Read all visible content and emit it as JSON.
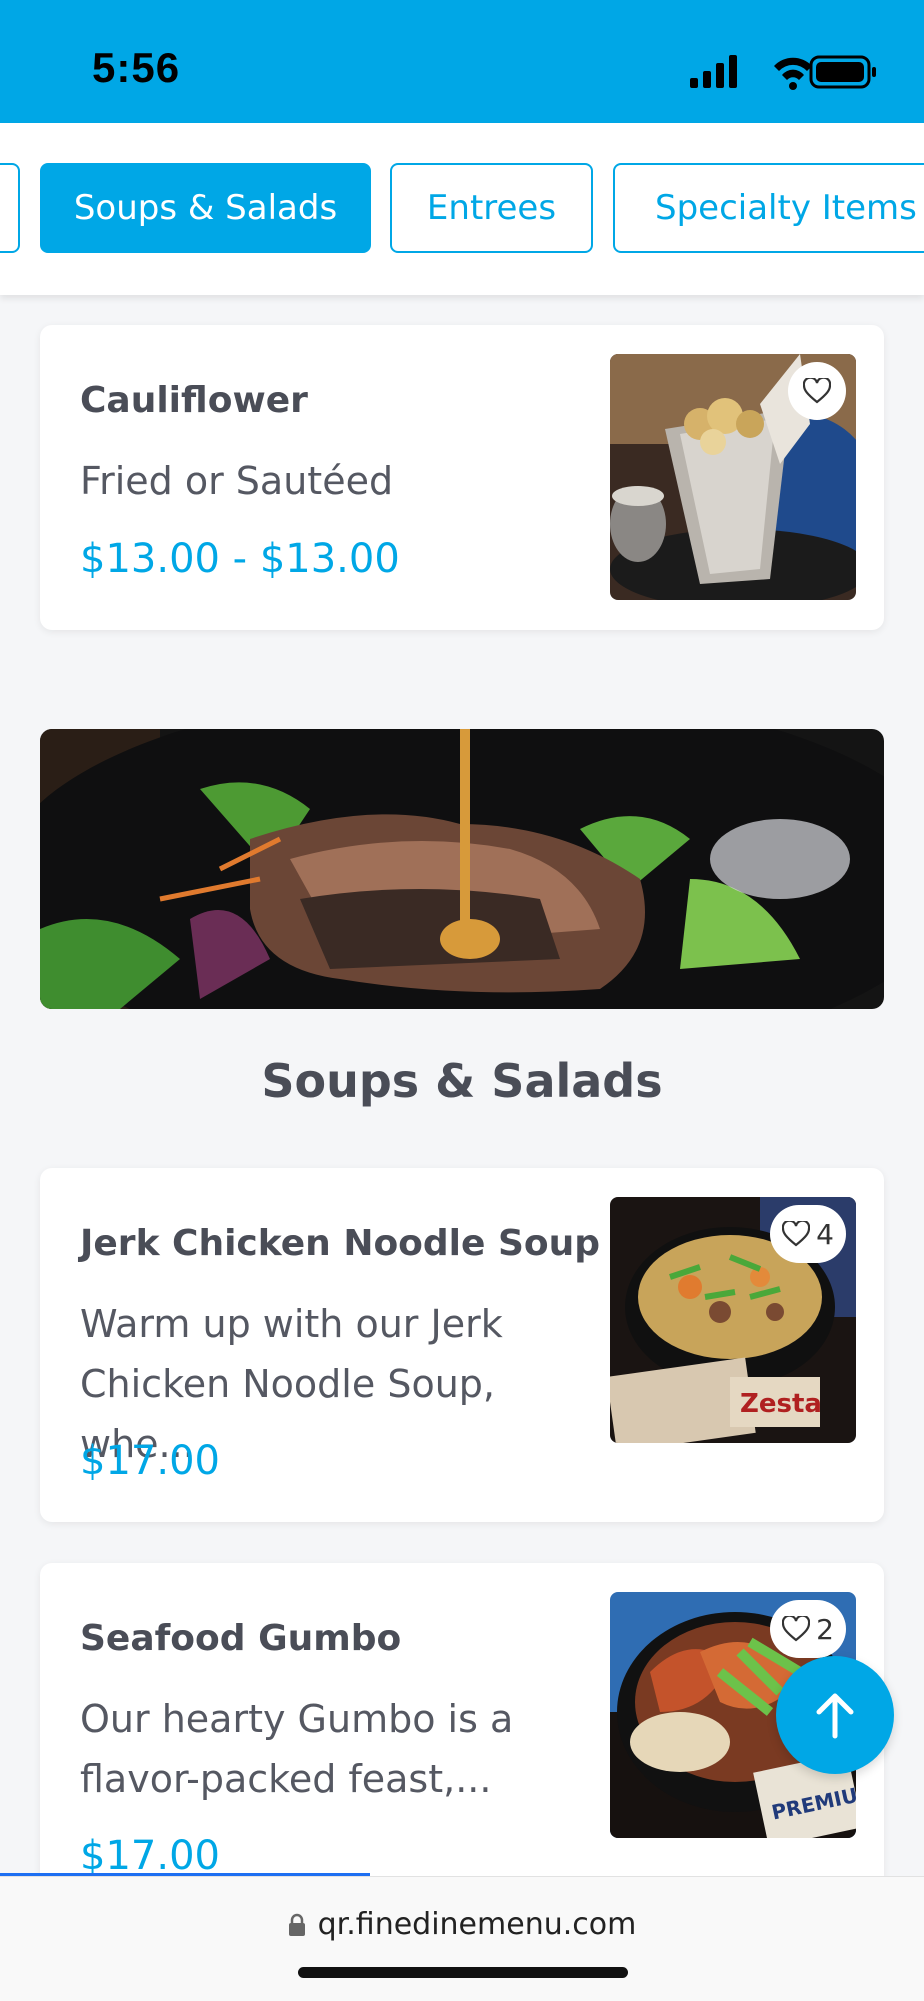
{
  "status": {
    "time": "5:56"
  },
  "tabs": [
    {
      "label": ""
    },
    {
      "label": "Soups & Salads",
      "active": true
    },
    {
      "label": "Entrees"
    },
    {
      "label": "Specialty Items"
    }
  ],
  "items_top": [
    {
      "name": "Cauliflower",
      "description": "Fried or Sautéed",
      "price": "$13.00 - $13.00",
      "favorites": ""
    }
  ],
  "section": {
    "title": "Soups & Salads"
  },
  "items": [
    {
      "name": "Jerk Chicken Noodle Soup",
      "description_line1": "Warm up with our Jerk",
      "description_line2": "Chicken Noodle Soup, whe...",
      "price": "$17.00",
      "favorites": "4"
    },
    {
      "name": "Seafood Gumbo",
      "description_line1": "Our hearty Gumbo is a",
      "description_line2": "flavor-packed feast,...",
      "price": "$17.00",
      "favorites": "2"
    }
  ],
  "browser": {
    "url": "qr.finedinemenu.com"
  },
  "colors": {
    "accent": "#00a7e6",
    "text": "#4a4d57"
  },
  "icons": [
    "signal-icon",
    "wifi-icon",
    "battery-icon",
    "heart-icon",
    "arrow-up-icon",
    "lock-icon"
  ]
}
